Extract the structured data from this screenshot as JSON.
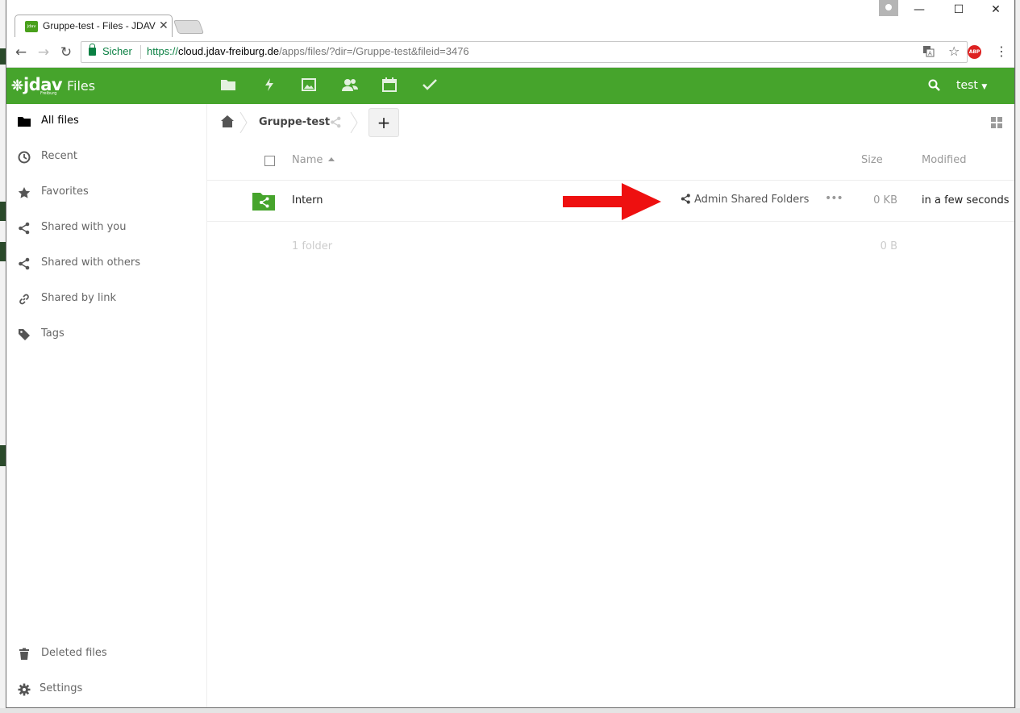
{
  "browser": {
    "tab_title": "Gruppe-test - Files - JDAV",
    "tab_favicon_text": "jdav",
    "secure_label": "Sicher",
    "url_protocol": "https://",
    "url_host": "cloud.jdav-freiburg.de",
    "url_path": "/apps/files/?dir=/Gruppe-test&fileid=3476",
    "abp_label": "ABP"
  },
  "header": {
    "logo_text": "jdav",
    "logo_subtext": "Freiburg",
    "app_name": "Files",
    "user_name": "test",
    "brand_color": "#46a42c",
    "app_icons": [
      "folder-icon",
      "activity-icon",
      "gallery-icon",
      "contacts-icon",
      "calendar-icon",
      "tasks-icon"
    ]
  },
  "sidebar": {
    "items": [
      {
        "label": "All files",
        "icon": "folder-icon"
      },
      {
        "label": "Recent",
        "icon": "clock-icon"
      },
      {
        "label": "Favorites",
        "icon": "star-icon"
      },
      {
        "label": "Shared with you",
        "icon": "share-icon"
      },
      {
        "label": "Shared with others",
        "icon": "share-icon"
      },
      {
        "label": "Shared by link",
        "icon": "link-icon"
      },
      {
        "label": "Tags",
        "icon": "tag-icon"
      }
    ],
    "deleted_label": "Deleted files",
    "settings_label": "Settings"
  },
  "breadcrumb": {
    "current": "Gruppe-test",
    "new_label": "+"
  },
  "table": {
    "col_name": "Name",
    "col_size": "Size",
    "col_modified": "Modified",
    "rows": [
      {
        "name": "Intern",
        "share": "Admin Shared Folders",
        "size": "0 KB",
        "modified": "in a few seconds"
      }
    ],
    "summary_count": "1 folder",
    "summary_size": "0 B"
  }
}
